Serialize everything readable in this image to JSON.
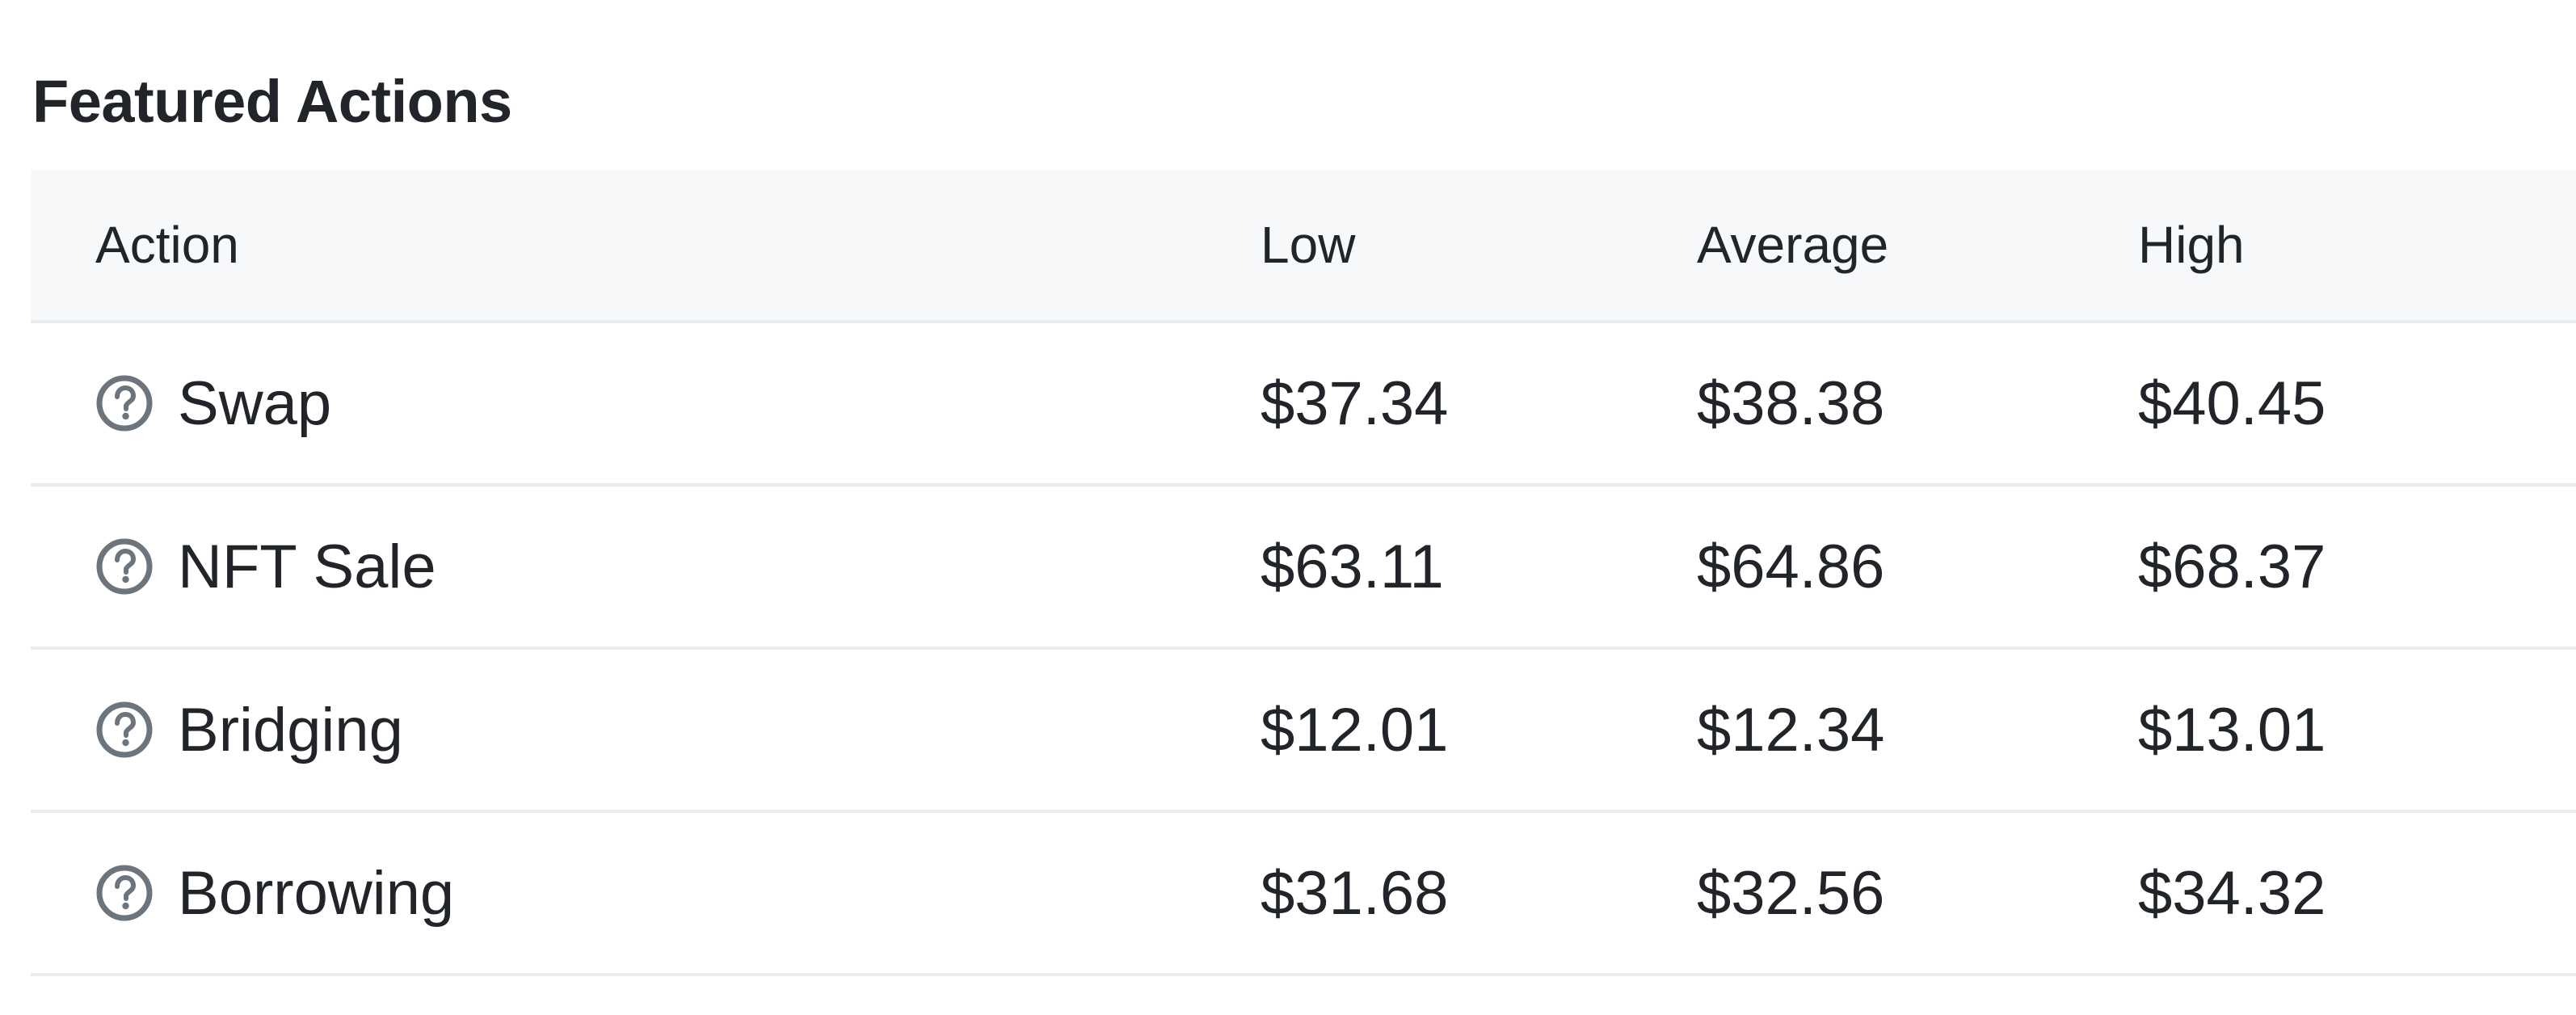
{
  "section": {
    "title": "Featured Actions"
  },
  "table": {
    "headers": {
      "action": "Action",
      "low": "Low",
      "average": "Average",
      "high": "High"
    },
    "rows": [
      {
        "action": "Swap",
        "low": "$37.34",
        "average": "$38.38",
        "high": "$40.45",
        "icon": "question-circle-icon"
      },
      {
        "action": "NFT Sale",
        "low": "$63.11",
        "average": "$64.86",
        "high": "$68.37",
        "icon": "question-circle-icon"
      },
      {
        "action": "Bridging",
        "low": "$12.01",
        "average": "$12.34",
        "high": "$13.01",
        "icon": "question-circle-icon"
      },
      {
        "action": "Borrowing",
        "low": "$31.68",
        "average": "$32.56",
        "high": "$34.32",
        "icon": "question-circle-icon"
      }
    ]
  },
  "colors": {
    "text": "#212529",
    "header_background": "#f7f8f9",
    "divider": "#e9ecef",
    "icon": "#6c757d"
  }
}
